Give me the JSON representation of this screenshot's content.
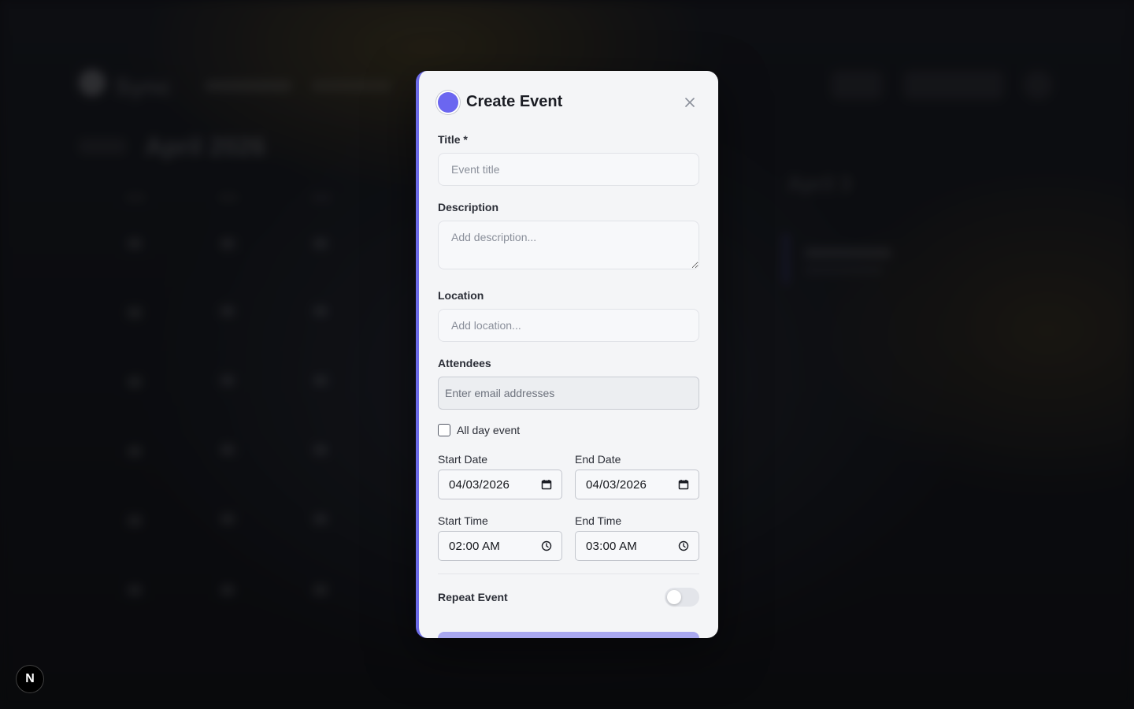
{
  "background": {
    "brand": "Sync",
    "month": "April 2026",
    "right_panel_title": "April 3"
  },
  "modal": {
    "title": "Create Event",
    "accent_color": "#6b66f0",
    "close_icon": "close-icon",
    "fields": {
      "title_label": "Title *",
      "title_placeholder": "Event title",
      "description_label": "Description",
      "description_placeholder": "Add description...",
      "location_label": "Location",
      "location_placeholder": "Add location...",
      "attendees_label": "Attendees",
      "attendees_placeholder": "Enter email addresses",
      "all_day_label": "All day event",
      "all_day_checked": false,
      "start_date_label": "Start Date",
      "start_date_value": "04/03/2026",
      "end_date_label": "End Date",
      "end_date_value": "04/03/2026",
      "start_time_label": "Start Time",
      "start_time_value": "02:00 AM",
      "end_time_label": "End Time",
      "end_time_value": "03:00 AM",
      "repeat_label": "Repeat Event",
      "repeat_enabled": false
    }
  },
  "next_badge": "N"
}
